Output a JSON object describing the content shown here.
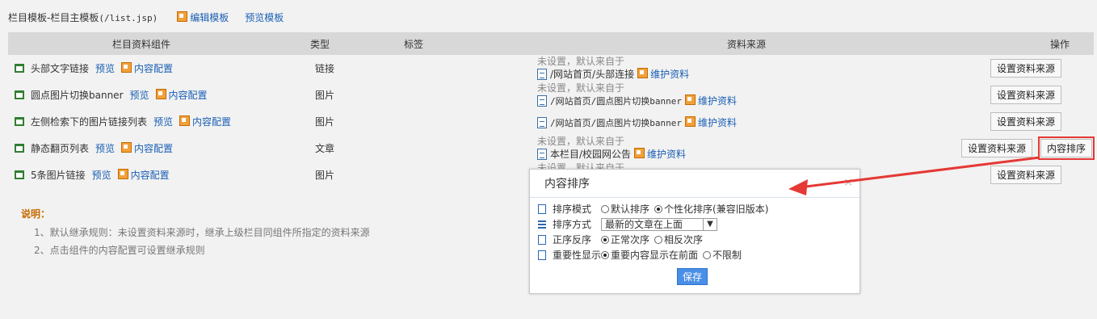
{
  "topbar": {
    "title": "栏目模板-栏目主模板",
    "file": "(/list.jsp)",
    "edit_link": "编辑模板",
    "preview_link": "预览模板"
  },
  "table": {
    "headers": [
      "栏目资料组件",
      "类型",
      "标签",
      "资料来源",
      "操作"
    ],
    "rows": [
      {
        "name": "头部文字链接",
        "preview": "预览",
        "config": "内容配置",
        "type": "链接",
        "note": "未设置，默认来自于",
        "path": "/网站首页/头部连接",
        "maintain": "维护资料",
        "buttons": [
          "设置资料来源"
        ]
      },
      {
        "name": "圆点图片切换banner",
        "preview": "预览",
        "config": "内容配置",
        "type": "图片",
        "note": "未设置，默认来自于",
        "path": "/网站首页/圆点图片切换banner",
        "maintain": "维护资料",
        "buttons": [
          "设置资料来源"
        ]
      },
      {
        "name": "左侧检索下的图片链接列表",
        "preview": "预览",
        "config": "内容配置",
        "type": "图片",
        "note": "",
        "path": "/网站首页/圆点图片切换banner",
        "maintain": "维护资料",
        "buttons": [
          "设置资料来源"
        ]
      },
      {
        "name": "静态翻页列表",
        "preview": "预览",
        "config": "内容配置",
        "type": "文章",
        "note": "未设置，默认来自于",
        "path": "本栏目/校园网公告",
        "maintain": "维护资料",
        "buttons": [
          "设置资料来源",
          "内容排序"
        ]
      },
      {
        "name": "5条图片链接",
        "preview": "预览",
        "config": "内容配置",
        "type": "图片",
        "note": "未设置，默认来自于",
        "path": "",
        "maintain": "",
        "buttons": [
          "设置资料来源"
        ]
      }
    ]
  },
  "notes": {
    "title": "说明：",
    "items": [
      "1、默认继承规则：未设置资料来源时，继承上级栏目同组件所指定的资料来源",
      "2、点击组件的内容配置可设置继承规则"
    ]
  },
  "dialog": {
    "title": "内容排序",
    "close": "×",
    "rows": {
      "mode_label": "排序模式",
      "mode_opt1": "默认排序",
      "mode_opt2": "个性化排序(兼容旧版本)",
      "method_label": "排序方式",
      "method_value": "最新的文章在上面",
      "order_label": "正序反序",
      "order_opt1": "正常次序",
      "order_opt2": "相反次序",
      "importance_label": "重要性显示",
      "importance_opt1": "重要内容显示在前面",
      "importance_opt2": "不限制"
    },
    "save": "保存"
  },
  "colors": {
    "accent": "#4a8fe7",
    "annotation": "#e53935",
    "link": "#1a5fb4"
  }
}
